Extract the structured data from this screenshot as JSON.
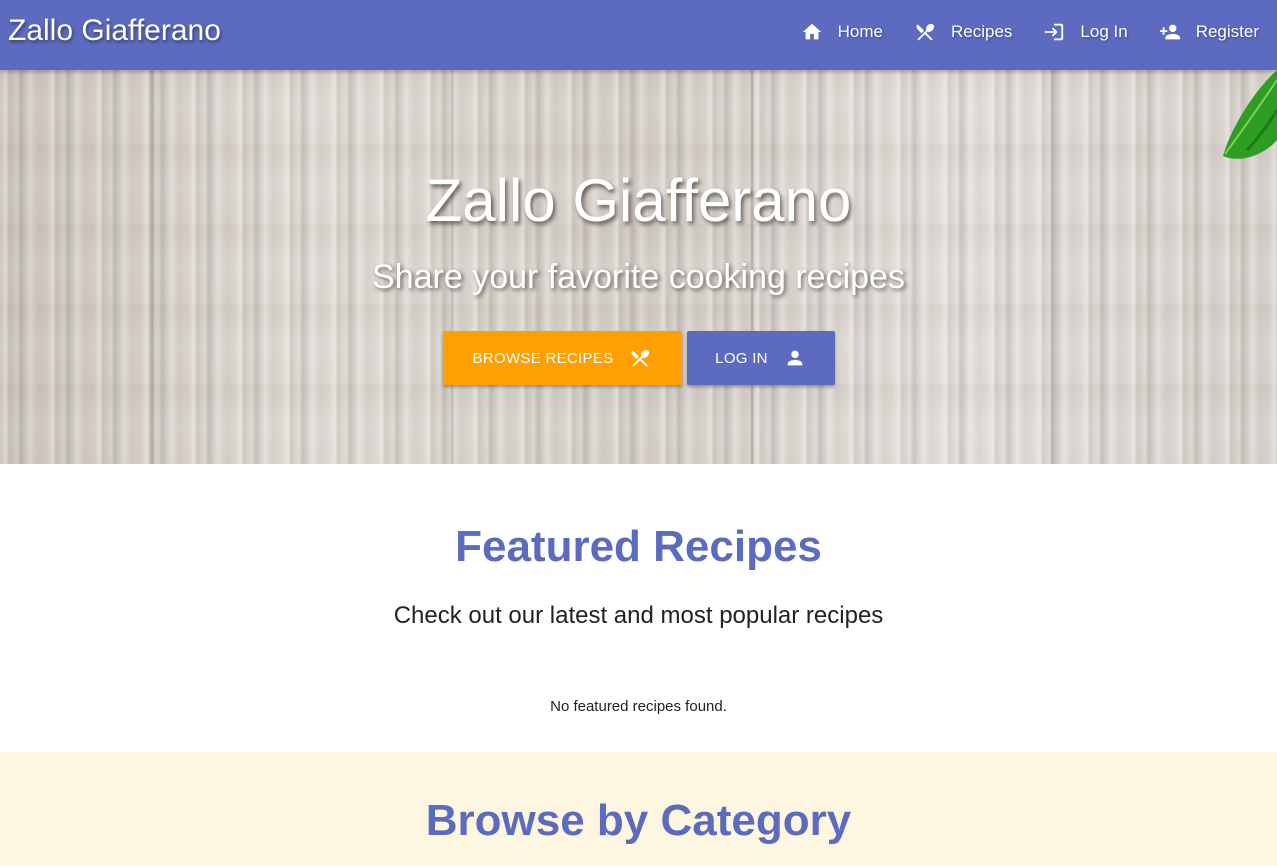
{
  "navbar": {
    "brand": "Zallo Giafferano",
    "links": [
      {
        "label": "Home",
        "icon": "home-icon"
      },
      {
        "label": "Recipes",
        "icon": "utensils-icon"
      },
      {
        "label": "Log In",
        "icon": "login-icon"
      },
      {
        "label": "Register",
        "icon": "person-add-icon"
      }
    ]
  },
  "hero": {
    "title": "Zallo Giafferano",
    "subtitle": "Share your favorite cooking recipes",
    "browse_button": "BROWSE RECIPES",
    "login_button": "LOG IN"
  },
  "featured": {
    "title": "Featured Recipes",
    "subtitle": "Check out our latest and most popular recipes",
    "empty_message": "No featured recipes found."
  },
  "category": {
    "title": "Browse by Category"
  },
  "colors": {
    "primary": "#5c6bc0",
    "accent": "#ffa000",
    "category_background": "#fdf6e1"
  }
}
